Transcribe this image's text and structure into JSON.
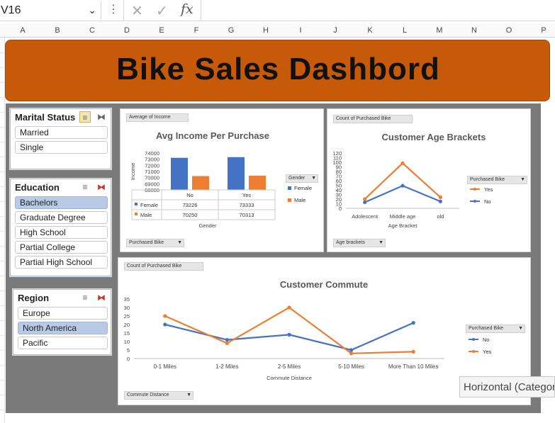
{
  "formula_bar": {
    "name_box": "V16",
    "cancel_glyph": "✕",
    "enter_glyph": "✓",
    "fx_label": "fx",
    "formula": ""
  },
  "columns": [
    "A",
    "B",
    "C",
    "D",
    "E",
    "F",
    "G",
    "H",
    "I",
    "J",
    "K",
    "L",
    "M",
    "N",
    "O",
    "P"
  ],
  "banner": {
    "title": "Bike Sales Dashbord",
    "color": "#c65a09"
  },
  "slicers": {
    "marital": {
      "title": "Marital Status",
      "items": [
        {
          "label": "Married",
          "selected": true
        },
        {
          "label": "Single",
          "selected": true
        }
      ]
    },
    "education": {
      "title": "Education",
      "items": [
        {
          "label": "Bachelors",
          "selected": true
        },
        {
          "label": "Graduate Degree",
          "selected": false
        },
        {
          "label": "High School",
          "selected": false
        },
        {
          "label": "Partial College",
          "selected": false
        },
        {
          "label": "Partial High School",
          "selected": false
        }
      ]
    },
    "region": {
      "title": "Region",
      "items": [
        {
          "label": "Europe",
          "selected": false
        },
        {
          "label": "North America",
          "selected": true
        },
        {
          "label": "Pacific",
          "selected": false
        }
      ]
    }
  },
  "charts": {
    "income": {
      "value_field": "Average of Income",
      "filter_field": "Purchased Bike",
      "legend_field": "Gender",
      "row_field": "Gender"
    },
    "age": {
      "value_field": "Count of Purchased Bike",
      "filter_field": "Age brackets",
      "legend_field": "Purchased Bike"
    },
    "commute": {
      "value_field": "Count of Purchased Bike",
      "filter_field": "Commute Distance",
      "legend_field": "Purchased Bike"
    }
  },
  "tooltip": {
    "text": "Horizontal (Category) Axis"
  },
  "chart_data": [
    {
      "type": "bar",
      "title": "Avg Income Per Purchase",
      "xlabel": "Gender",
      "ylabel": "Income",
      "categories": [
        "No",
        "Yes"
      ],
      "series": [
        {
          "name": "Female",
          "values": [
            73226,
            73333
          ],
          "color": "#4472c4"
        },
        {
          "name": "Male",
          "values": [
            70250,
            70313
          ],
          "color": "#ed7d31"
        }
      ],
      "ylim": [
        68000,
        74000
      ],
      "yticks": [
        68000,
        69000,
        70000,
        71000,
        72000,
        73000,
        74000
      ],
      "data_table": {
        "rows": [
          {
            "label": "Female",
            "values": [
              "73226",
              "73333"
            ]
          },
          {
            "label": "Male",
            "values": [
              "70250",
              "70313"
            ]
          }
        ]
      },
      "legend": "right"
    },
    {
      "type": "line",
      "title": "Customer Age Brackets",
      "xlabel": "Age Bracket",
      "categories": [
        "Adolescent",
        "Middle age",
        "old"
      ],
      "series": [
        {
          "name": "Yes",
          "values": [
            20,
            98,
            24
          ],
          "color": "#ed7d31"
        },
        {
          "name": "No",
          "values": [
            13,
            49,
            15
          ],
          "color": "#4472c4"
        }
      ],
      "ylim": [
        0,
        120
      ],
      "yticks": [
        0,
        10,
        20,
        30,
        40,
        50,
        60,
        70,
        80,
        90,
        100,
        110,
        120
      ],
      "legend": "right"
    },
    {
      "type": "line",
      "title": "Customer Commute",
      "xlabel": "Commute Distance",
      "categories": [
        "0-1 Miles",
        "1-2 Miles",
        "2-5 Miles",
        "5-10 Miles",
        "More Than 10 Miles"
      ],
      "series": [
        {
          "name": "No",
          "values": [
            20,
            11,
            14,
            5,
            21
          ],
          "color": "#4472c4"
        },
        {
          "name": "Yes",
          "values": [
            25,
            9,
            30,
            3,
            4
          ],
          "color": "#ed7d31"
        }
      ],
      "ylim": [
        0,
        35
      ],
      "yticks": [
        0,
        5,
        10,
        15,
        20,
        25,
        30,
        35
      ],
      "legend": "right"
    }
  ]
}
